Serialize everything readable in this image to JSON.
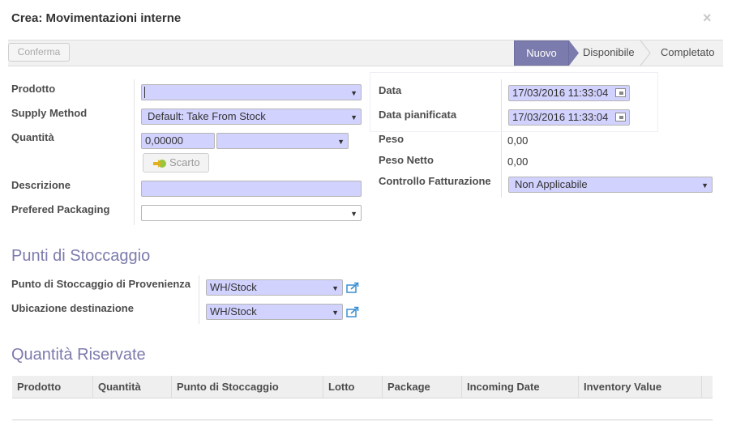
{
  "dialog": {
    "title": "Crea: Movimentazioni interne",
    "close_label": "×"
  },
  "statusbar": {
    "confirm_label": "Conferma",
    "stages": [
      "Nuovo",
      "Disponibile",
      "Completato"
    ],
    "active_stage": "Nuovo"
  },
  "form_left": {
    "product_label": "Prodotto",
    "product_value": "",
    "supply_method_label": "Supply Method",
    "supply_method_value": "Default: Take From Stock",
    "quantity_label": "Quantità",
    "quantity_value": "0,00000",
    "uom_value": "",
    "scrap_button_label": "Scarto",
    "description_label": "Descrizione",
    "description_value": "",
    "packaging_label": "Prefered Packaging",
    "packaging_value": ""
  },
  "form_right": {
    "date_label": "Data",
    "date_value": "17/03/2016 11:33:04",
    "scheduled_label": "Data pianificata",
    "scheduled_value": "17/03/2016 11:33:04",
    "weight_label": "Peso",
    "weight_value": "0,00",
    "net_weight_label": "Peso Netto",
    "net_weight_value": "0,00",
    "invoice_control_label": "Controllo Fatturazione",
    "invoice_control_value": "Non Applicabile"
  },
  "locations": {
    "section_title": "Punti di Stoccaggio",
    "source_label": "Punto di Stoccaggio di Provenienza",
    "source_value": "WH/Stock",
    "dest_label": "Ubicazione destinazione",
    "dest_value": "WH/Stock"
  },
  "reserved": {
    "section_title": "Quantità Riservate",
    "columns": [
      "Prodotto",
      "Quantità",
      "Punto di Stoccaggio",
      "Lotto",
      "Package",
      "Incoming Date",
      "Inventory Value"
    ]
  },
  "colors": {
    "accent": "#7c7bad",
    "input_required": "#d2d2ff"
  }
}
